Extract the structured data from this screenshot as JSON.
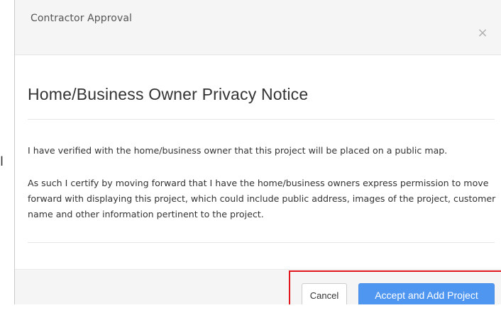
{
  "background_page": {
    "partial_glyph": "l"
  },
  "modal": {
    "header": {
      "title": "Contractor Approval",
      "close_icon_glyph": "×"
    },
    "body": {
      "title": "Home/Business Owner Privacy Notice",
      "paragraph_1": "I have verified with the home/business owner that this project will be placed on a public map.",
      "paragraph_2": "As such I certify by moving forward that I have the home/business owners express permission to move forward with displaying this project, which could include public address, images of the project, customer name and other information pertinent to the project."
    },
    "footer": {
      "cancel_label": "Cancel",
      "accept_label": "Accept and Add Project"
    }
  },
  "colors": {
    "primary_button": "#4f96f0",
    "highlight_border": "#e0161c",
    "header_bg": "#f5f5f5",
    "footer_bg": "#f5f5f5",
    "close_icon": "#b0b0b0"
  }
}
